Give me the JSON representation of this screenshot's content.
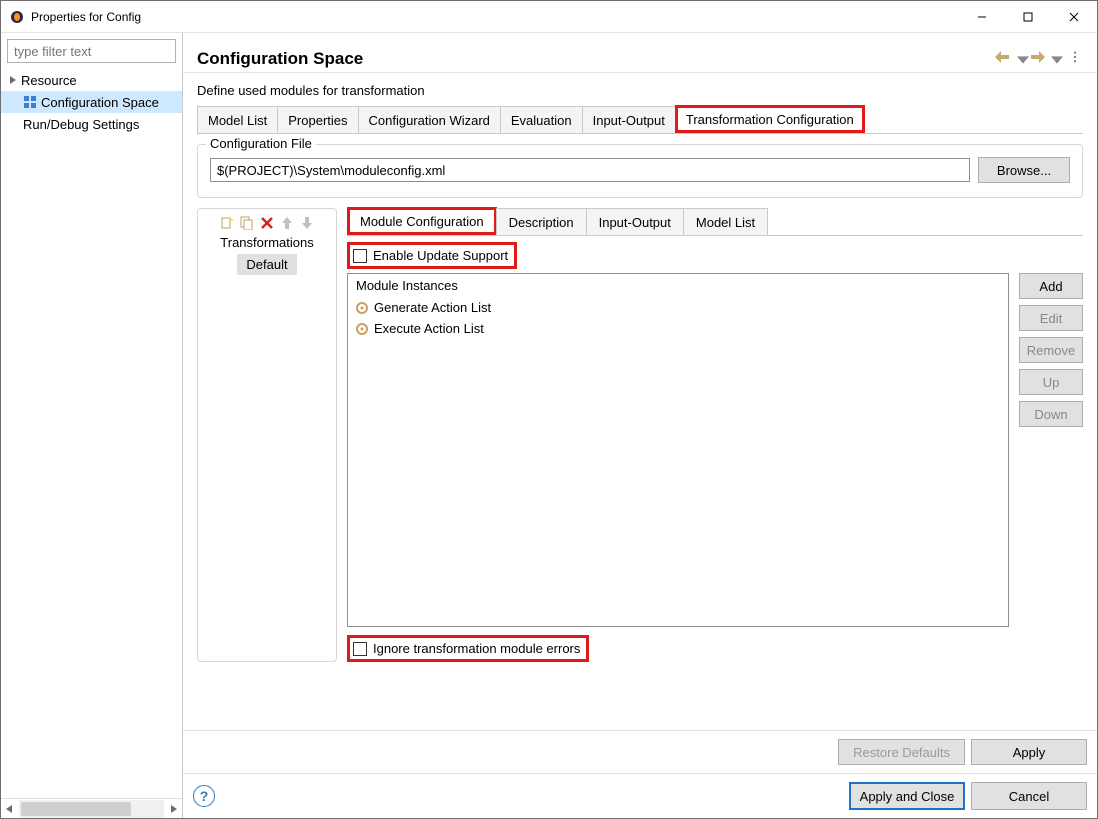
{
  "window": {
    "title": "Properties for Config"
  },
  "sidebar": {
    "filter_placeholder": "type filter text",
    "items": [
      {
        "label": "Resource"
      },
      {
        "label": "Configuration Space",
        "selected": true
      },
      {
        "label": "Run/Debug Settings"
      }
    ]
  },
  "header": {
    "title": "Configuration Space"
  },
  "subtitle": "Define used modules for transformation",
  "tabs": {
    "items": [
      "Model List",
      "Properties",
      "Configuration Wizard",
      "Evaluation",
      "Input-Output",
      "Transformation Configuration"
    ],
    "active": 5
  },
  "config_file": {
    "legend": "Configuration File",
    "value": "$(PROJECT)\\System\\moduleconfig.xml",
    "browse": "Browse..."
  },
  "leftpane": {
    "label": "Transformations",
    "default": "Default"
  },
  "subtabs": {
    "items": [
      "Module Configuration",
      "Description",
      "Input-Output",
      "Model List"
    ],
    "active": 0
  },
  "checks": {
    "enable_update": "Enable Update Support",
    "ignore_errors": "Ignore transformation module errors"
  },
  "module_instances": {
    "title": "Module Instances",
    "items": [
      "Generate Action List",
      "Execute Action List"
    ]
  },
  "instance_buttons": {
    "add": "Add",
    "edit": "Edit",
    "remove": "Remove",
    "up": "Up",
    "down": "Down"
  },
  "footer": {
    "restore": "Restore Defaults",
    "apply": "Apply"
  },
  "bottom": {
    "apply_close": "Apply and Close",
    "cancel": "Cancel"
  }
}
